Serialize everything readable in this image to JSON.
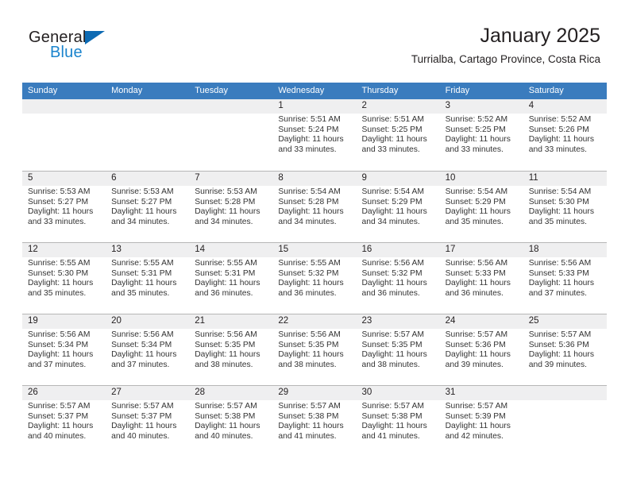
{
  "brand": {
    "name_top": "General",
    "name_bottom": "Blue",
    "triangle_color": "#0d6ab3",
    "blue_text_color": "#1b84cd"
  },
  "header": {
    "title": "January 2025",
    "subtitle": "Turrialba, Cartago Province, Costa Rica"
  },
  "theme": {
    "header_blue": "#3a7cbe",
    "daynum_band": "#efeff0",
    "row_border": "#b6b6b6",
    "text": "#231f20"
  },
  "weekdays": [
    "Sunday",
    "Monday",
    "Tuesday",
    "Wednesday",
    "Thursday",
    "Friday",
    "Saturday"
  ],
  "weeks": [
    [
      {
        "day": "",
        "sunrise": "",
        "sunset": "",
        "daylight_line1": "",
        "daylight_line2": ""
      },
      {
        "day": "",
        "sunrise": "",
        "sunset": "",
        "daylight_line1": "",
        "daylight_line2": ""
      },
      {
        "day": "",
        "sunrise": "",
        "sunset": "",
        "daylight_line1": "",
        "daylight_line2": ""
      },
      {
        "day": "1",
        "sunrise": "Sunrise: 5:51 AM",
        "sunset": "Sunset: 5:24 PM",
        "daylight_line1": "Daylight: 11 hours",
        "daylight_line2": "and 33 minutes."
      },
      {
        "day": "2",
        "sunrise": "Sunrise: 5:51 AM",
        "sunset": "Sunset: 5:25 PM",
        "daylight_line1": "Daylight: 11 hours",
        "daylight_line2": "and 33 minutes."
      },
      {
        "day": "3",
        "sunrise": "Sunrise: 5:52 AM",
        "sunset": "Sunset: 5:25 PM",
        "daylight_line1": "Daylight: 11 hours",
        "daylight_line2": "and 33 minutes."
      },
      {
        "day": "4",
        "sunrise": "Sunrise: 5:52 AM",
        "sunset": "Sunset: 5:26 PM",
        "daylight_line1": "Daylight: 11 hours",
        "daylight_line2": "and 33 minutes."
      }
    ],
    [
      {
        "day": "5",
        "sunrise": "Sunrise: 5:53 AM",
        "sunset": "Sunset: 5:27 PM",
        "daylight_line1": "Daylight: 11 hours",
        "daylight_line2": "and 33 minutes."
      },
      {
        "day": "6",
        "sunrise": "Sunrise: 5:53 AM",
        "sunset": "Sunset: 5:27 PM",
        "daylight_line1": "Daylight: 11 hours",
        "daylight_line2": "and 34 minutes."
      },
      {
        "day": "7",
        "sunrise": "Sunrise: 5:53 AM",
        "sunset": "Sunset: 5:28 PM",
        "daylight_line1": "Daylight: 11 hours",
        "daylight_line2": "and 34 minutes."
      },
      {
        "day": "8",
        "sunrise": "Sunrise: 5:54 AM",
        "sunset": "Sunset: 5:28 PM",
        "daylight_line1": "Daylight: 11 hours",
        "daylight_line2": "and 34 minutes."
      },
      {
        "day": "9",
        "sunrise": "Sunrise: 5:54 AM",
        "sunset": "Sunset: 5:29 PM",
        "daylight_line1": "Daylight: 11 hours",
        "daylight_line2": "and 34 minutes."
      },
      {
        "day": "10",
        "sunrise": "Sunrise: 5:54 AM",
        "sunset": "Sunset: 5:29 PM",
        "daylight_line1": "Daylight: 11 hours",
        "daylight_line2": "and 35 minutes."
      },
      {
        "day": "11",
        "sunrise": "Sunrise: 5:54 AM",
        "sunset": "Sunset: 5:30 PM",
        "daylight_line1": "Daylight: 11 hours",
        "daylight_line2": "and 35 minutes."
      }
    ],
    [
      {
        "day": "12",
        "sunrise": "Sunrise: 5:55 AM",
        "sunset": "Sunset: 5:30 PM",
        "daylight_line1": "Daylight: 11 hours",
        "daylight_line2": "and 35 minutes."
      },
      {
        "day": "13",
        "sunrise": "Sunrise: 5:55 AM",
        "sunset": "Sunset: 5:31 PM",
        "daylight_line1": "Daylight: 11 hours",
        "daylight_line2": "and 35 minutes."
      },
      {
        "day": "14",
        "sunrise": "Sunrise: 5:55 AM",
        "sunset": "Sunset: 5:31 PM",
        "daylight_line1": "Daylight: 11 hours",
        "daylight_line2": "and 36 minutes."
      },
      {
        "day": "15",
        "sunrise": "Sunrise: 5:55 AM",
        "sunset": "Sunset: 5:32 PM",
        "daylight_line1": "Daylight: 11 hours",
        "daylight_line2": "and 36 minutes."
      },
      {
        "day": "16",
        "sunrise": "Sunrise: 5:56 AM",
        "sunset": "Sunset: 5:32 PM",
        "daylight_line1": "Daylight: 11 hours",
        "daylight_line2": "and 36 minutes."
      },
      {
        "day": "17",
        "sunrise": "Sunrise: 5:56 AM",
        "sunset": "Sunset: 5:33 PM",
        "daylight_line1": "Daylight: 11 hours",
        "daylight_line2": "and 36 minutes."
      },
      {
        "day": "18",
        "sunrise": "Sunrise: 5:56 AM",
        "sunset": "Sunset: 5:33 PM",
        "daylight_line1": "Daylight: 11 hours",
        "daylight_line2": "and 37 minutes."
      }
    ],
    [
      {
        "day": "19",
        "sunrise": "Sunrise: 5:56 AM",
        "sunset": "Sunset: 5:34 PM",
        "daylight_line1": "Daylight: 11 hours",
        "daylight_line2": "and 37 minutes."
      },
      {
        "day": "20",
        "sunrise": "Sunrise: 5:56 AM",
        "sunset": "Sunset: 5:34 PM",
        "daylight_line1": "Daylight: 11 hours",
        "daylight_line2": "and 37 minutes."
      },
      {
        "day": "21",
        "sunrise": "Sunrise: 5:56 AM",
        "sunset": "Sunset: 5:35 PM",
        "daylight_line1": "Daylight: 11 hours",
        "daylight_line2": "and 38 minutes."
      },
      {
        "day": "22",
        "sunrise": "Sunrise: 5:56 AM",
        "sunset": "Sunset: 5:35 PM",
        "daylight_line1": "Daylight: 11 hours",
        "daylight_line2": "and 38 minutes."
      },
      {
        "day": "23",
        "sunrise": "Sunrise: 5:57 AM",
        "sunset": "Sunset: 5:35 PM",
        "daylight_line1": "Daylight: 11 hours",
        "daylight_line2": "and 38 minutes."
      },
      {
        "day": "24",
        "sunrise": "Sunrise: 5:57 AM",
        "sunset": "Sunset: 5:36 PM",
        "daylight_line1": "Daylight: 11 hours",
        "daylight_line2": "and 39 minutes."
      },
      {
        "day": "25",
        "sunrise": "Sunrise: 5:57 AM",
        "sunset": "Sunset: 5:36 PM",
        "daylight_line1": "Daylight: 11 hours",
        "daylight_line2": "and 39 minutes."
      }
    ],
    [
      {
        "day": "26",
        "sunrise": "Sunrise: 5:57 AM",
        "sunset": "Sunset: 5:37 PM",
        "daylight_line1": "Daylight: 11 hours",
        "daylight_line2": "and 40 minutes."
      },
      {
        "day": "27",
        "sunrise": "Sunrise: 5:57 AM",
        "sunset": "Sunset: 5:37 PM",
        "daylight_line1": "Daylight: 11 hours",
        "daylight_line2": "and 40 minutes."
      },
      {
        "day": "28",
        "sunrise": "Sunrise: 5:57 AM",
        "sunset": "Sunset: 5:38 PM",
        "daylight_line1": "Daylight: 11 hours",
        "daylight_line2": "and 40 minutes."
      },
      {
        "day": "29",
        "sunrise": "Sunrise: 5:57 AM",
        "sunset": "Sunset: 5:38 PM",
        "daylight_line1": "Daylight: 11 hours",
        "daylight_line2": "and 41 minutes."
      },
      {
        "day": "30",
        "sunrise": "Sunrise: 5:57 AM",
        "sunset": "Sunset: 5:38 PM",
        "daylight_line1": "Daylight: 11 hours",
        "daylight_line2": "and 41 minutes."
      },
      {
        "day": "31",
        "sunrise": "Sunrise: 5:57 AM",
        "sunset": "Sunset: 5:39 PM",
        "daylight_line1": "Daylight: 11 hours",
        "daylight_line2": "and 42 minutes."
      },
      {
        "day": "",
        "sunrise": "",
        "sunset": "",
        "daylight_line1": "",
        "daylight_line2": ""
      }
    ]
  ]
}
